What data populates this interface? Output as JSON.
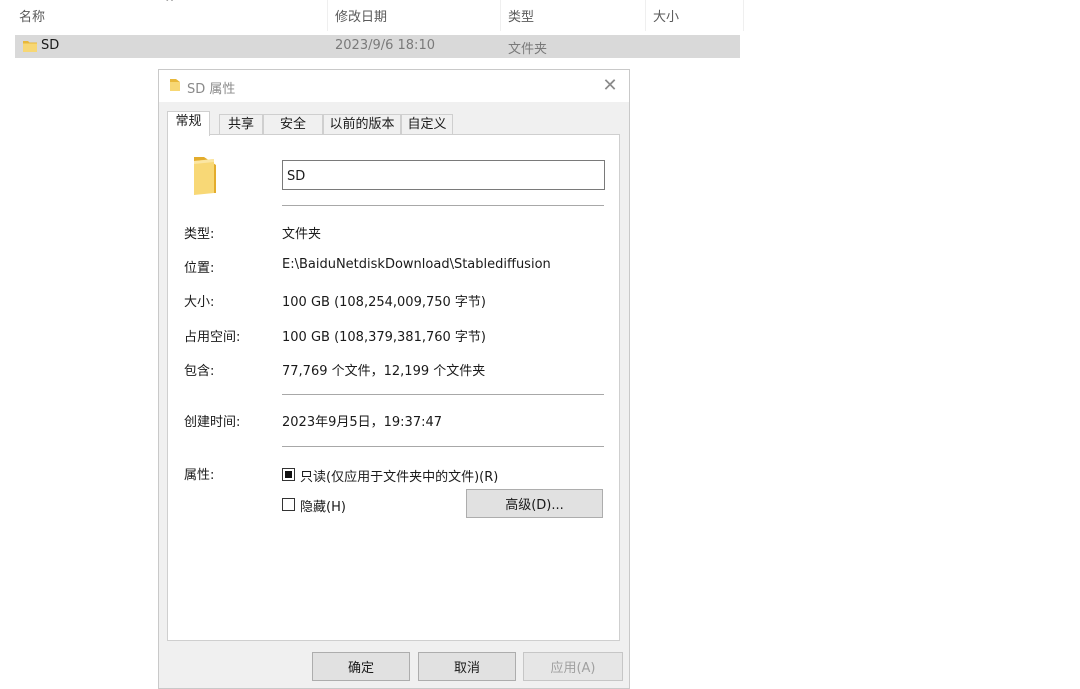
{
  "explorer": {
    "columns": {
      "name": "名称",
      "modified": "修改日期",
      "type": "类型",
      "size": "大小"
    },
    "row": {
      "name": "SD",
      "modified": "2023/9/6 18:10",
      "type": "文件夹"
    }
  },
  "dialog": {
    "title": "SD 属性",
    "tabs": [
      "常规",
      "共享",
      "安全",
      "以前的版本",
      "自定义"
    ],
    "active_tab": "常规",
    "folder_name": "SD",
    "fields": {
      "type": {
        "label": "类型:",
        "value": "文件夹"
      },
      "location": {
        "label": "位置:",
        "value": "E:\\BaiduNetdiskDownload\\Stablediffusion"
      },
      "size": {
        "label": "大小:",
        "value": "100 GB (108,254,009,750 字节)"
      },
      "size_on_disk": {
        "label": "占用空间:",
        "value": "100 GB (108,379,381,760 字节)"
      },
      "contains": {
        "label": "包含:",
        "value": "77,769 个文件，12,199 个文件夹"
      },
      "created": {
        "label": "创建时间:",
        "value": "2023年9月5日，19:37:47"
      }
    },
    "attributes": {
      "label": "属性:",
      "readonly": {
        "label": "只读(仅应用于文件夹中的文件)(R)",
        "state": "indeterminate"
      },
      "hidden": {
        "label": "隐藏(H)",
        "state": "unchecked"
      },
      "advanced_label": "高级(D)..."
    },
    "buttons": {
      "ok": "确定",
      "cancel": "取消",
      "apply": "应用(A)"
    }
  }
}
